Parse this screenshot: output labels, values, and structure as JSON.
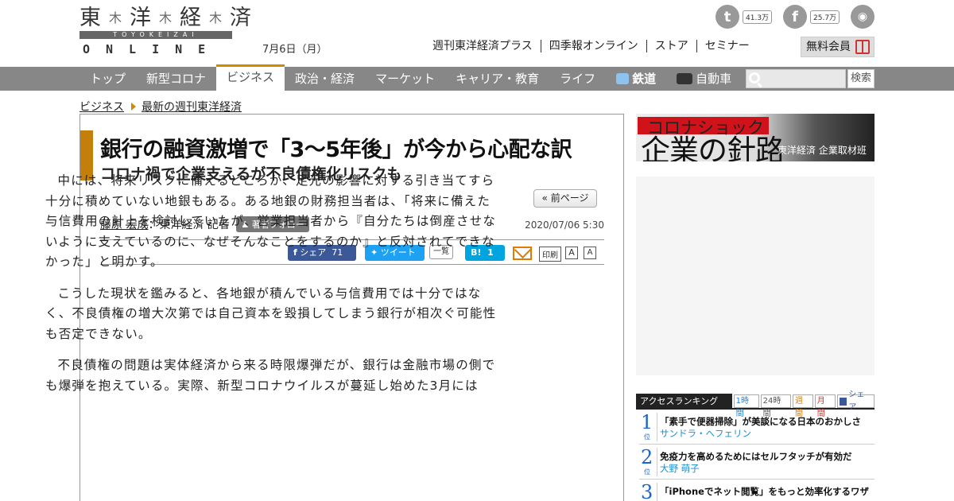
{
  "header": {
    "logo_kanji": [
      "東",
      "洋",
      "経",
      "済"
    ],
    "logo_sub": "TOYOKEIZAI",
    "logo_online": "ONLINE",
    "date": "7月6日（月）",
    "links": [
      "週刊東洋経済プラス",
      "四季報オンライン",
      "ストア",
      "セミナー"
    ],
    "member_button": "無料会員",
    "twitter_count": "41.3万",
    "facebook_count": "25.7万"
  },
  "nav": {
    "items": [
      "トップ",
      "新型コロナ",
      "ビジネス",
      "政治・経済",
      "マーケット",
      "キャリア・教育",
      "ライフ",
      "鉄道",
      "自動車"
    ],
    "search_button": "検索"
  },
  "breadcrumb": [
    "ビジネス",
    "最新の週刊東洋経済"
  ],
  "article": {
    "title": "銀行の融資激増で「3～5年後」が今から心配な訳",
    "subtitle": "コロナ禍で企業支えるが不良債権化リスクも",
    "prev_page": "« 前ページ",
    "author": "藤原 宏成",
    "author_role": "：東洋経済 記者",
    "follow_label": "著者フォロー",
    "published": "2020/07/06 5:30",
    "share": {
      "facebook_label": "シェア",
      "facebook_count": "71",
      "tweet_label": "ツイート",
      "list_label": "一覧",
      "hatena_label": "B!",
      "hatena_count": "1",
      "print_label": "印刷",
      "font_small": "A",
      "font_large": "A"
    },
    "paragraphs": [
      "中には、将来リスクに備えるどころか、足元の影響に対する引き当てすら十分に積めていない地銀もある。ある地銀の財務担当者は、「将来に備えた与信費用の計上を検討していたが、営業担当者から『自分たちは倒産させないように支えているのに、なぜそんなことをするのか』と反対されてできなかった」と明かす。",
      "こうした現状を鑑みると、各地銀が積んでいる与信費用では十分ではなく、不良債権の増大次第では自己資本を毀損してしまう銀行が相次ぐ可能性も否定できない。",
      "不良債権の問題は実体経済から来る時限爆弾だが、銀行は金融市場の側でも爆弾を抱えている。実際、新型コロナウイルスが蔓延し始めた3月には"
    ]
  },
  "sidebar": {
    "banner_kicker": "コロナショック",
    "banner_title": "企業の針路",
    "banner_credit": "東洋経済 企業取材班",
    "ranking_head": "アクセスランキング",
    "ranking_tabs": [
      "1時間",
      "24時間",
      "週間",
      "月間",
      "シェア"
    ],
    "ranking_unit": "位",
    "ranking": [
      {
        "num": "1",
        "title": "「素手で便器掃除」が美談になる日本のおかしさ",
        "author": "サンドラ・ヘフェリン"
      },
      {
        "num": "2",
        "title": "免疫力を高めるためにはセルフタッチが有効だ",
        "author": "大野 萌子"
      },
      {
        "num": "3",
        "title": "「iPhoneでネット閲覧」をもっと効率化するワザ",
        "author": ""
      }
    ]
  }
}
